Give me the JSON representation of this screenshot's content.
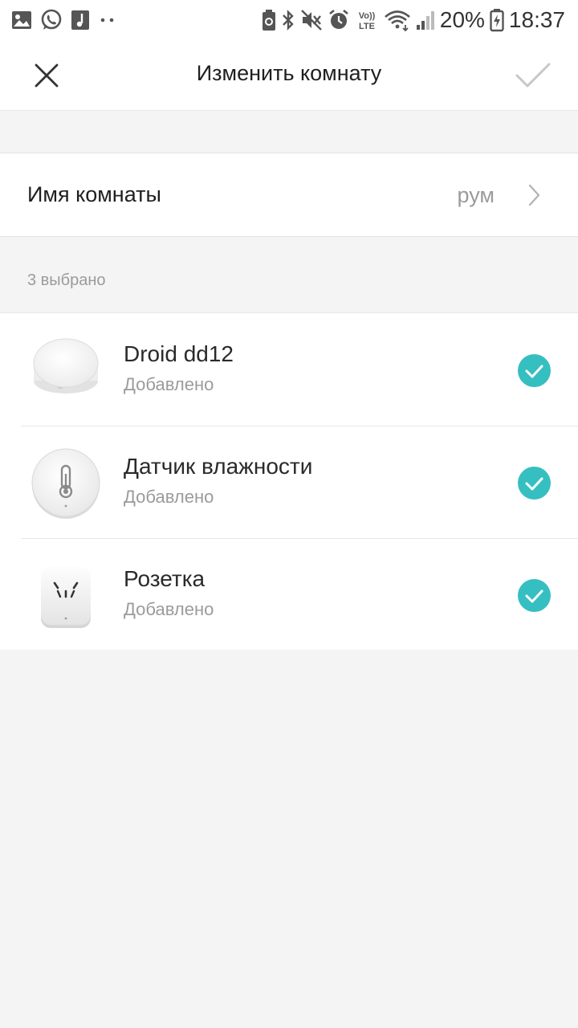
{
  "status_bar": {
    "battery": "20%",
    "time": "18:37",
    "left_icons": [
      "gallery-icon",
      "whatsapp-icon",
      "music-icon",
      "more-dots-icon"
    ],
    "right_icons": [
      "battery-saver-icon",
      "bluetooth-icon",
      "mute-icon",
      "alarm-icon",
      "volte-icon",
      "wifi-icon",
      "signal-icon",
      "battery-icon"
    ]
  },
  "header": {
    "title": "Изменить комнату",
    "close_icon": "close-icon",
    "confirm_icon": "checkmark-icon"
  },
  "room": {
    "label": "Имя комнаты",
    "value": "рум",
    "chevron_icon": "chevron-right-icon"
  },
  "selection": {
    "count_label": "3 выбрано"
  },
  "devices": [
    {
      "name": "Droid dd12",
      "status": "Добавлено",
      "icon": "gateway-icon",
      "selected": true
    },
    {
      "name": "Датчик влажности",
      "status": "Добавлено",
      "icon": "humidity-sensor-icon",
      "selected": true
    },
    {
      "name": "Розетка",
      "status": "Добавлено",
      "icon": "socket-icon",
      "selected": true
    }
  ],
  "colors": {
    "accent": "#36bfc1",
    "background": "#f4f4f4",
    "surface": "#ffffff",
    "secondary_text": "#9b9b9b",
    "confirm_disabled": "#c7c7c7"
  }
}
